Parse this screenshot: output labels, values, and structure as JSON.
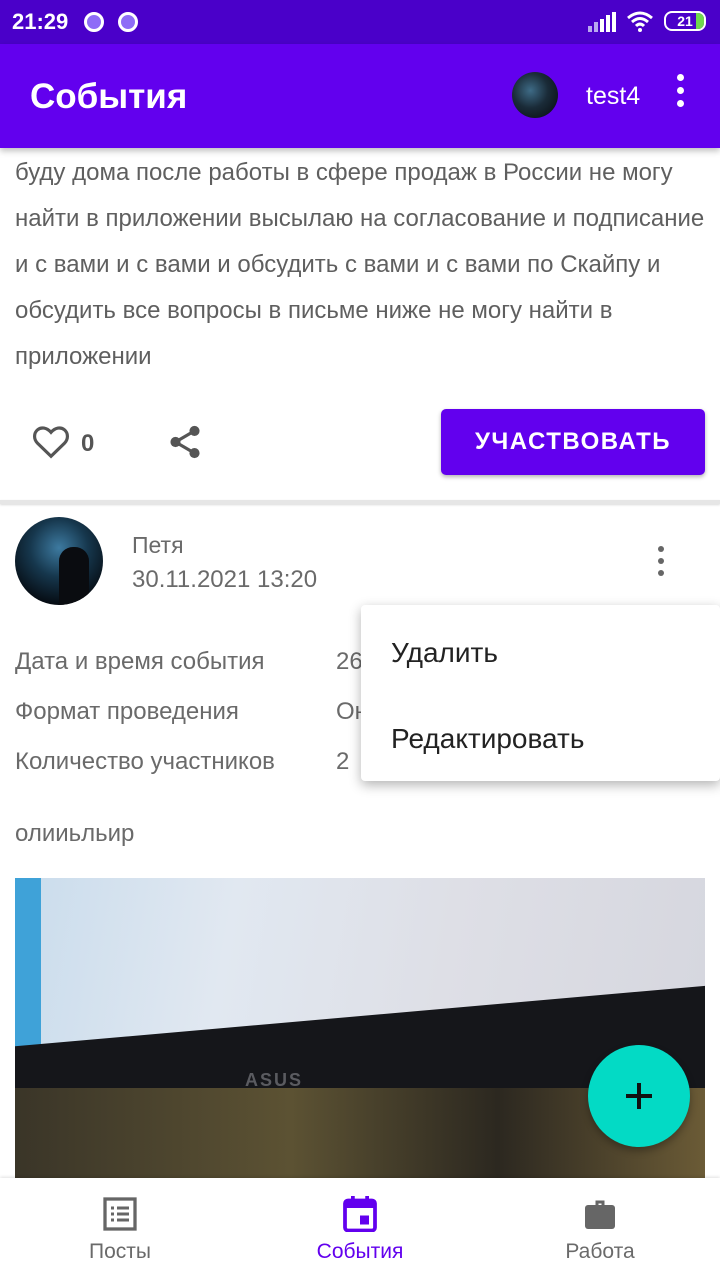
{
  "status_bar": {
    "time": "21:29",
    "battery": "21"
  },
  "app_bar": {
    "title": "События",
    "username": "test4"
  },
  "post": {
    "text": "буду дома после работы в сфере продаж в России не могу найти в приложении высылаю на согласование и подписание и с вами и с вами и обсудить с вами и с вами по Скайпу и обсудить все вопросы в письме ниже не могу найти в приложении",
    "like_count": "0",
    "participate_label": "УЧАСТВОВАТЬ"
  },
  "event": {
    "author": "Петя",
    "published": "30.11.2021 13:20",
    "details": [
      {
        "label": "Дата и время события",
        "value": "26"
      },
      {
        "label": "Формат проведения",
        "value": "Он"
      },
      {
        "label": "Количество участников",
        "value": "2"
      }
    ],
    "description": "олииьльир",
    "photo_logo": "ASUS"
  },
  "popup_menu": {
    "items": [
      "Удалить",
      "Редактировать"
    ]
  },
  "bottom_nav": {
    "items": [
      {
        "label": "Посты",
        "icon": "list-icon"
      },
      {
        "label": "События",
        "icon": "calendar-icon"
      },
      {
        "label": "Работа",
        "icon": "briefcase-icon"
      }
    ],
    "active": "События"
  },
  "colors": {
    "primary": "#6200ee",
    "status_bar": "#4a00c9",
    "fab": "#03dac5"
  }
}
